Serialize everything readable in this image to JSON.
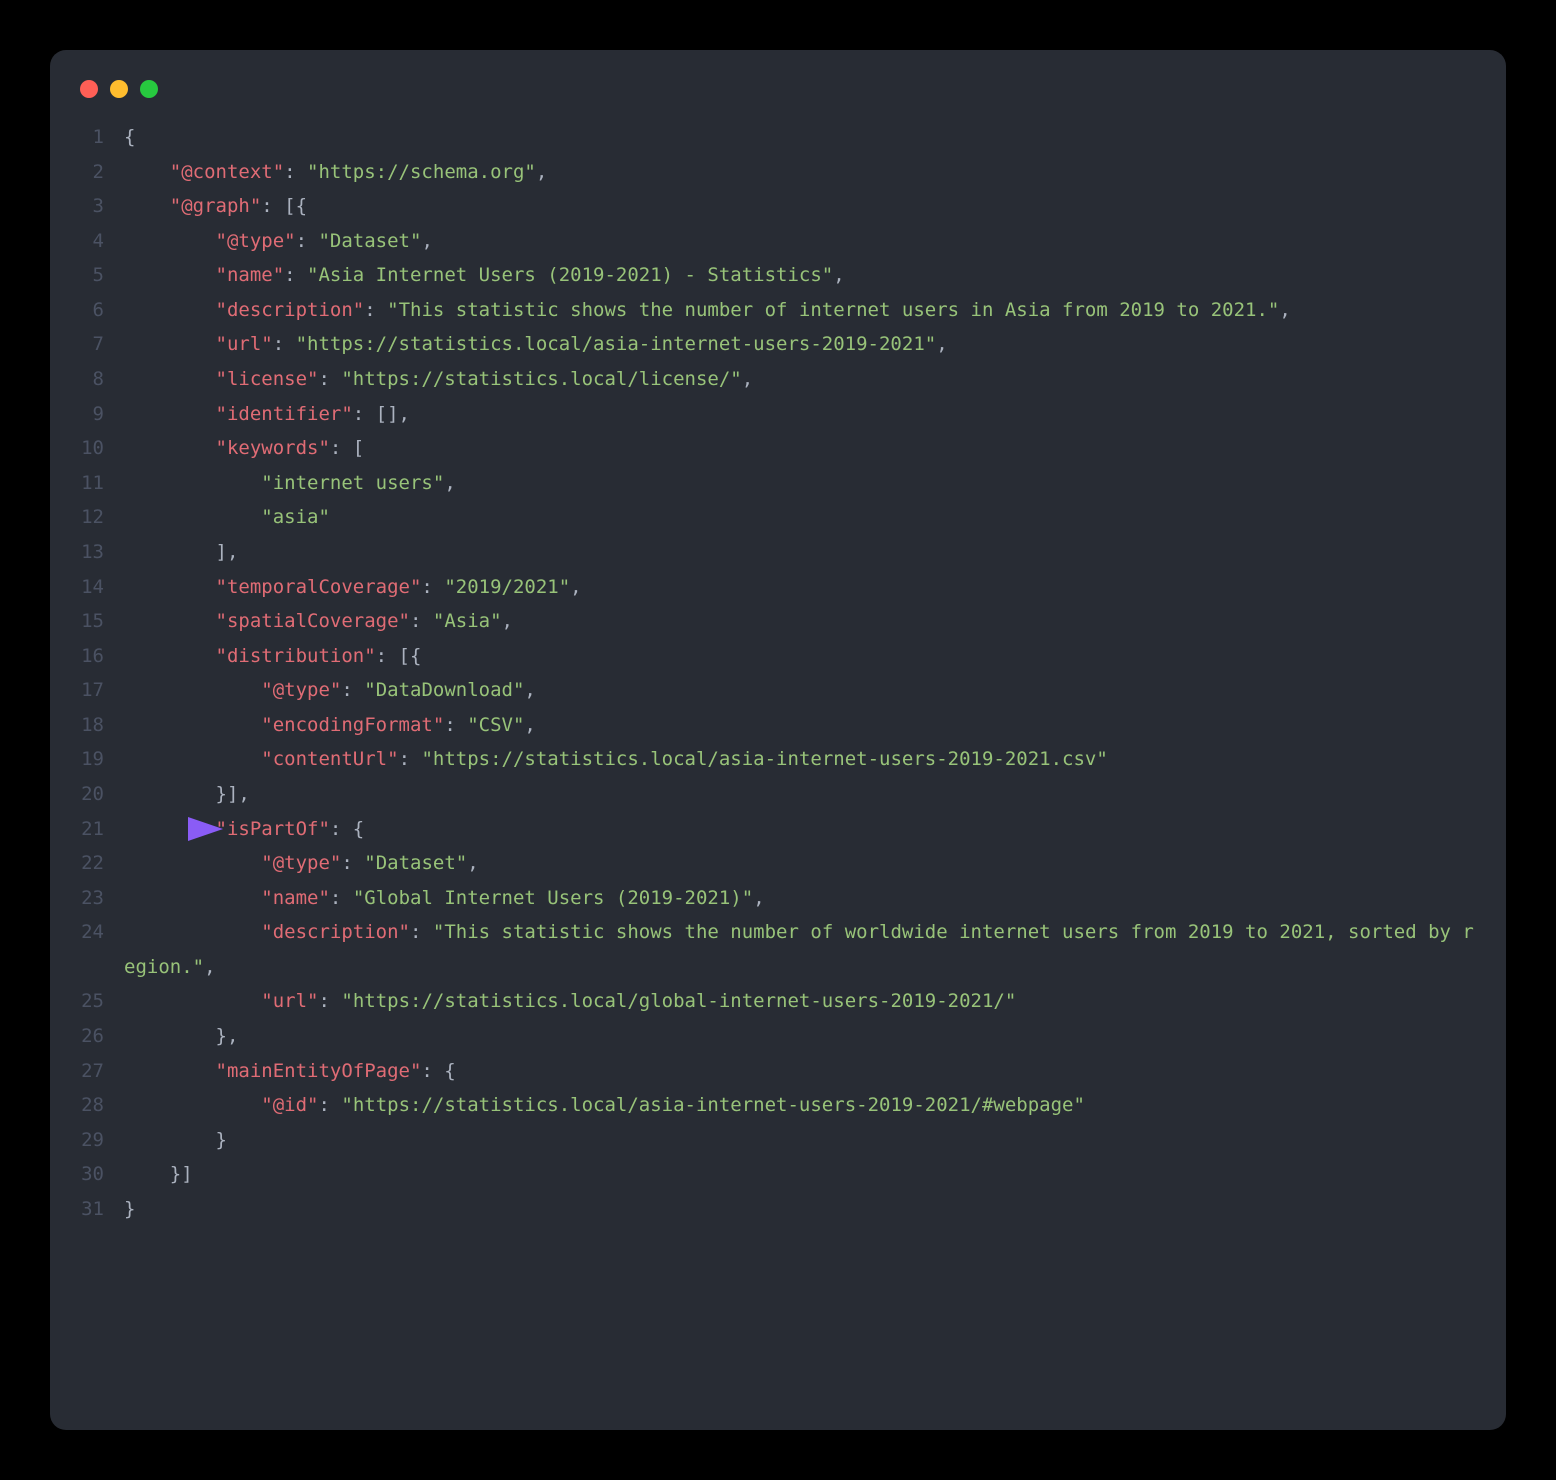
{
  "window": {
    "dots": [
      "red",
      "yellow",
      "green"
    ]
  },
  "code": {
    "highlight_line": 21,
    "lines": [
      {
        "n": 1,
        "tokens": [
          [
            "p",
            "{"
          ]
        ]
      },
      {
        "n": 2,
        "tokens": [
          [
            "p",
            "    "
          ],
          [
            "k",
            "\"@context\""
          ],
          [
            "p",
            ": "
          ],
          [
            "s",
            "\"https://schema.org\""
          ],
          [
            "p",
            ","
          ]
        ]
      },
      {
        "n": 3,
        "tokens": [
          [
            "p",
            "    "
          ],
          [
            "k",
            "\"@graph\""
          ],
          [
            "p",
            ": [{"
          ]
        ]
      },
      {
        "n": 4,
        "tokens": [
          [
            "p",
            "        "
          ],
          [
            "k",
            "\"@type\""
          ],
          [
            "p",
            ": "
          ],
          [
            "s",
            "\"Dataset\""
          ],
          [
            "p",
            ","
          ]
        ]
      },
      {
        "n": 5,
        "tokens": [
          [
            "p",
            "        "
          ],
          [
            "k",
            "\"name\""
          ],
          [
            "p",
            ": "
          ],
          [
            "s",
            "\"Asia Internet Users (2019-2021) - Statistics\""
          ],
          [
            "p",
            ","
          ]
        ]
      },
      {
        "n": 6,
        "tokens": [
          [
            "p",
            "        "
          ],
          [
            "k",
            "\"description\""
          ],
          [
            "p",
            ": "
          ],
          [
            "s",
            "\"This statistic shows the number of internet users in Asia from 2019 to 2021.\""
          ],
          [
            "p",
            ","
          ]
        ]
      },
      {
        "n": 7,
        "tokens": [
          [
            "p",
            "        "
          ],
          [
            "k",
            "\"url\""
          ],
          [
            "p",
            ": "
          ],
          [
            "s",
            "\"https://statistics.local/asia-internet-users-2019-2021\""
          ],
          [
            "p",
            ","
          ]
        ]
      },
      {
        "n": 8,
        "tokens": [
          [
            "p",
            "        "
          ],
          [
            "k",
            "\"license\""
          ],
          [
            "p",
            ": "
          ],
          [
            "s",
            "\"https://statistics.local/license/\""
          ],
          [
            "p",
            ","
          ]
        ]
      },
      {
        "n": 9,
        "tokens": [
          [
            "p",
            "        "
          ],
          [
            "k",
            "\"identifier\""
          ],
          [
            "p",
            ": [],"
          ]
        ]
      },
      {
        "n": 10,
        "tokens": [
          [
            "p",
            "        "
          ],
          [
            "k",
            "\"keywords\""
          ],
          [
            "p",
            ": ["
          ]
        ]
      },
      {
        "n": 11,
        "tokens": [
          [
            "p",
            "            "
          ],
          [
            "s",
            "\"internet users\""
          ],
          [
            "p",
            ","
          ]
        ]
      },
      {
        "n": 12,
        "tokens": [
          [
            "p",
            "            "
          ],
          [
            "s",
            "\"asia\""
          ]
        ]
      },
      {
        "n": 13,
        "tokens": [
          [
            "p",
            "        ],"
          ]
        ]
      },
      {
        "n": 14,
        "tokens": [
          [
            "p",
            "        "
          ],
          [
            "k",
            "\"temporalCoverage\""
          ],
          [
            "p",
            ": "
          ],
          [
            "s",
            "\"2019/2021\""
          ],
          [
            "p",
            ","
          ]
        ]
      },
      {
        "n": 15,
        "tokens": [
          [
            "p",
            "        "
          ],
          [
            "k",
            "\"spatialCoverage\""
          ],
          [
            "p",
            ": "
          ],
          [
            "s",
            "\"Asia\""
          ],
          [
            "p",
            ","
          ]
        ]
      },
      {
        "n": 16,
        "tokens": [
          [
            "p",
            "        "
          ],
          [
            "k",
            "\"distribution\""
          ],
          [
            "p",
            ": [{"
          ]
        ]
      },
      {
        "n": 17,
        "tokens": [
          [
            "p",
            "            "
          ],
          [
            "k",
            "\"@type\""
          ],
          [
            "p",
            ": "
          ],
          [
            "s",
            "\"DataDownload\""
          ],
          [
            "p",
            ","
          ]
        ]
      },
      {
        "n": 18,
        "tokens": [
          [
            "p",
            "            "
          ],
          [
            "k",
            "\"encodingFormat\""
          ],
          [
            "p",
            ": "
          ],
          [
            "s",
            "\"CSV\""
          ],
          [
            "p",
            ","
          ]
        ]
      },
      {
        "n": 19,
        "tokens": [
          [
            "p",
            "            "
          ],
          [
            "k",
            "\"contentUrl\""
          ],
          [
            "p",
            ": "
          ],
          [
            "s",
            "\"https://statistics.local/asia-internet-users-2019-2021.csv\""
          ]
        ]
      },
      {
        "n": 20,
        "tokens": [
          [
            "p",
            "        }],"
          ]
        ]
      },
      {
        "n": 21,
        "tokens": [
          [
            "p",
            "        "
          ],
          [
            "k",
            "\"isPartOf\""
          ],
          [
            "p",
            ": {"
          ]
        ]
      },
      {
        "n": 22,
        "tokens": [
          [
            "p",
            "            "
          ],
          [
            "k",
            "\"@type\""
          ],
          [
            "p",
            ": "
          ],
          [
            "s",
            "\"Dataset\""
          ],
          [
            "p",
            ","
          ]
        ]
      },
      {
        "n": 23,
        "tokens": [
          [
            "p",
            "            "
          ],
          [
            "k",
            "\"name\""
          ],
          [
            "p",
            ": "
          ],
          [
            "s",
            "\"Global Internet Users (2019-2021)\""
          ],
          [
            "p",
            ","
          ]
        ]
      },
      {
        "n": 24,
        "tokens": [
          [
            "p",
            "            "
          ],
          [
            "k",
            "\"description\""
          ],
          [
            "p",
            ": "
          ],
          [
            "s",
            "\"This statistic shows the number of worldwide internet users from 2019 to 2021, sorted by region.\""
          ],
          [
            "p",
            ","
          ]
        ]
      },
      {
        "n": 25,
        "tokens": [
          [
            "p",
            "            "
          ],
          [
            "k",
            "\"url\""
          ],
          [
            "p",
            ": "
          ],
          [
            "s",
            "\"https://statistics.local/global-internet-users-2019-2021/\""
          ]
        ]
      },
      {
        "n": 26,
        "tokens": [
          [
            "p",
            "        },"
          ]
        ]
      },
      {
        "n": 27,
        "tokens": [
          [
            "p",
            "        "
          ],
          [
            "k",
            "\"mainEntityOfPage\""
          ],
          [
            "p",
            ": {"
          ]
        ]
      },
      {
        "n": 28,
        "tokens": [
          [
            "p",
            "            "
          ],
          [
            "k",
            "\"@id\""
          ],
          [
            "p",
            ": "
          ],
          [
            "s",
            "\"https://statistics.local/asia-internet-users-2019-2021/#webpage\""
          ]
        ]
      },
      {
        "n": 29,
        "tokens": [
          [
            "p",
            "        }"
          ]
        ]
      },
      {
        "n": 30,
        "tokens": [
          [
            "p",
            "    }]"
          ]
        ]
      },
      {
        "n": 31,
        "tokens": [
          [
            "p",
            "}"
          ]
        ]
      }
    ]
  }
}
